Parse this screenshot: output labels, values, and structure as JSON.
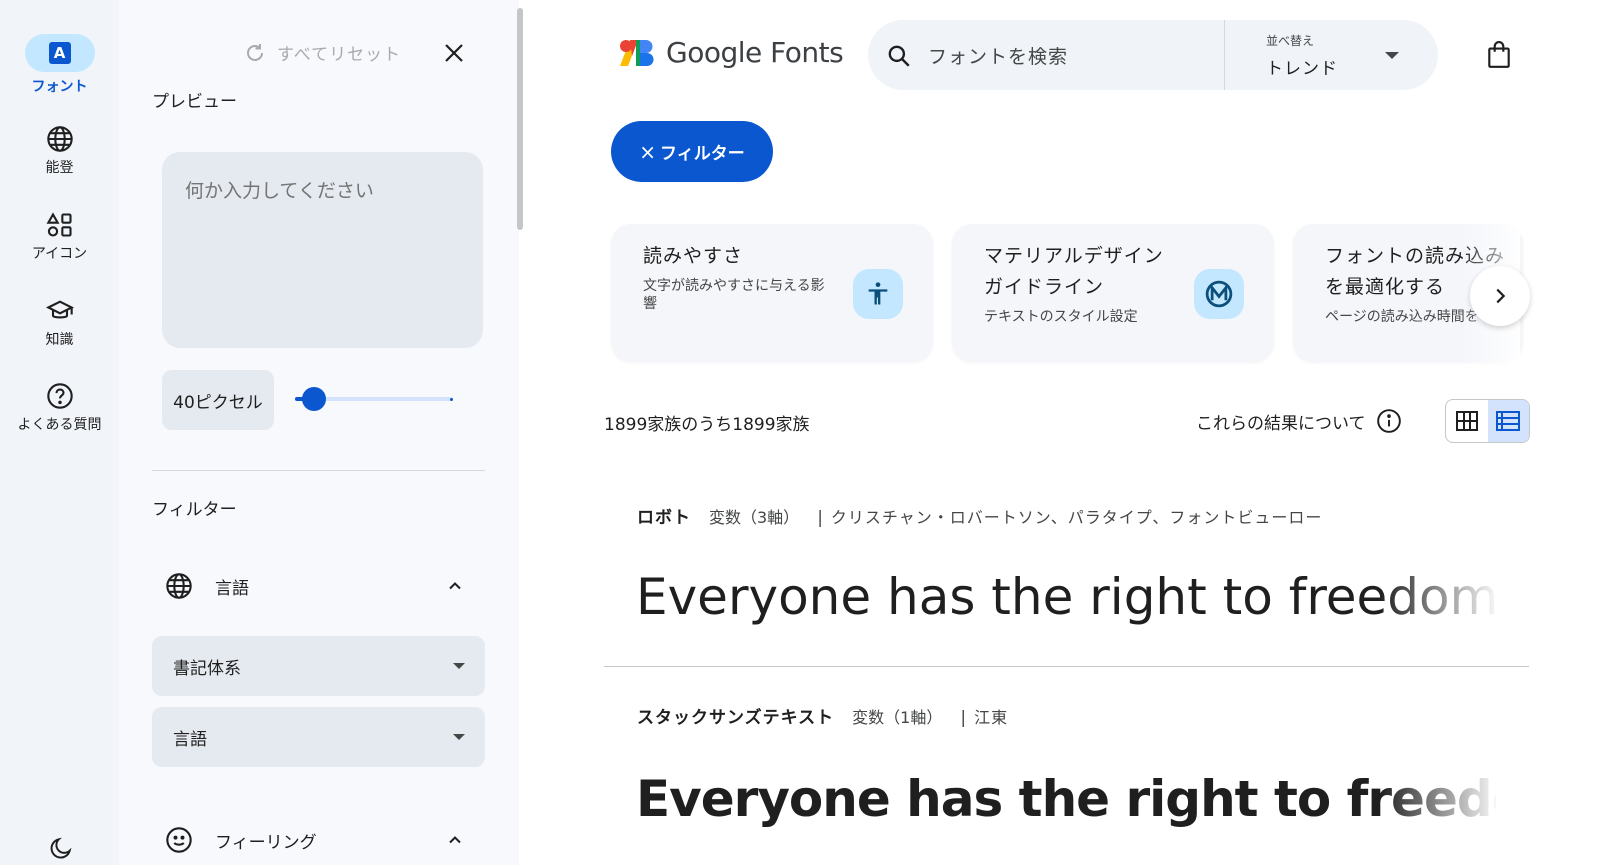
{
  "rail": {
    "items": [
      {
        "label": "フォント",
        "icon": "font-icon",
        "active": true
      },
      {
        "label": "能登",
        "icon": "globe-icon"
      },
      {
        "label": "アイコン",
        "icon": "shapes-icon"
      },
      {
        "label": "知識",
        "icon": "school-icon"
      },
      {
        "label": "よくある質問",
        "icon": "help-icon"
      }
    ],
    "font_glyph": "A",
    "theme_icon": "dark-mode-icon"
  },
  "panel": {
    "reset_label": "すべてリセット",
    "preview_heading": "プレビュー",
    "preview_placeholder": "何か入力してください",
    "size_label": "40ピクセル",
    "size_value_fraction": 0.08,
    "filter_heading": "フィルター",
    "language_section": "言語",
    "writing_system_dropdown": "書記体系",
    "language_dropdown": "言語",
    "feeling_section": "フィーリング"
  },
  "header": {
    "logo_text": "Google Fonts",
    "search_placeholder": "フォントを検索",
    "sort_label": "並べ替え",
    "sort_value": "トレンド"
  },
  "filter_button": {
    "x": "×",
    "label": "フィルター"
  },
  "cards": [
    {
      "title": "読みやすさ",
      "subtitle": "文字が読みやすさに与える影\n響",
      "icon": "accessibility-icon"
    },
    {
      "title": "マテリアルデザイン\nガイドライン",
      "subtitle": "テキストのスタイル設定",
      "icon": "material-icon"
    },
    {
      "title": "フォントの読み込み\nを最適化する",
      "subtitle": "ページの読み込み時間を",
      "icon": ""
    }
  ],
  "results": {
    "count_text": "1899家族のうち1899家族",
    "about_text": "これらの結果について"
  },
  "fonts": [
    {
      "name": "ロボト",
      "type": "変数（3軸）",
      "sep": "|",
      "authors": "クリスチャン・ロバートソン、パラタイプ、フォントビューロー",
      "sample": "Everyone has the right to freedom of th"
    },
    {
      "name": "スタックサンズテキスト",
      "type": "変数（1軸）",
      "sep": "|",
      "authors": "江東",
      "sample": "Everyone has the right to freedom"
    }
  ],
  "colors": {
    "accent": "#0b57d0",
    "accent_light": "#c2e7ff",
    "panel_bg": "#f7f9fc",
    "rail_bg": "#f1f4f9"
  }
}
